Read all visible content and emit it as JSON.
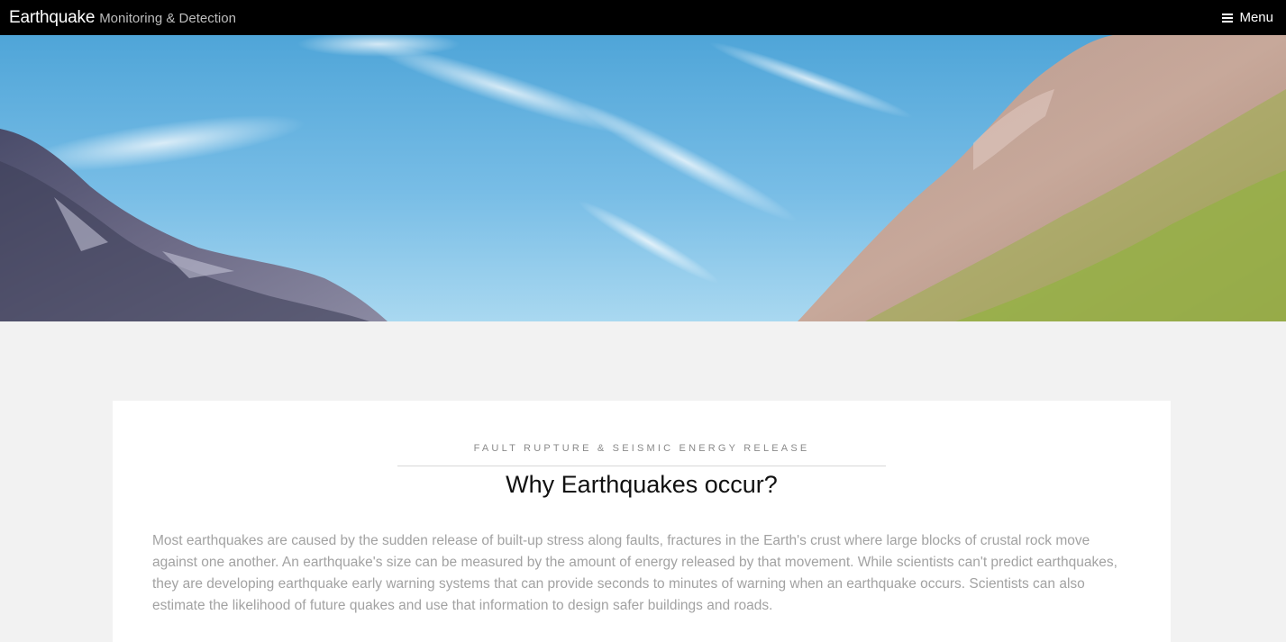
{
  "header": {
    "brand_main": "Earthquake",
    "brand_sub": "Monitoring & Detection",
    "menu_label": "Menu",
    "menu_icon": "hamburger-icon"
  },
  "hero": {
    "image": "mountain-valley-sky-photo"
  },
  "section": {
    "kicker": "FAULT RUPTURE & SEISMIC ENERGY RELEASE",
    "title": "Why Earthquakes occur?",
    "body": "Most earthquakes are caused by the sudden release of built-up stress along faults, fractures in the Earth's crust where large blocks of crustal rock move against one another. An earthquake's size can be measured by the amount of energy released by that movement. While scientists can't predict earthquakes, they are developing earthquake early warning systems that can provide seconds to minutes of warning when an earthquake occurs. Scientists can also estimate the likelihood of future quakes and use that information to design safer buildings and roads."
  },
  "colors": {
    "topbar_bg": "#000000",
    "page_bg": "#f2f2f2",
    "card_bg": "#ffffff",
    "body_text": "#a2a2a2",
    "sky_top": "#4fa7d9",
    "sky_bottom": "#9fd3ef"
  }
}
